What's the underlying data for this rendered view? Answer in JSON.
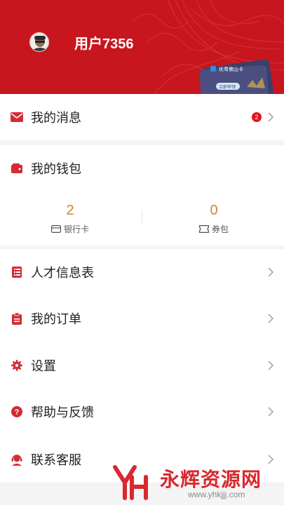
{
  "header": {
    "username": "用户7356",
    "promo_card_title": "优粤佛山卡",
    "promo_card_button": "立即申领"
  },
  "menu": {
    "messages": {
      "label": "我的消息",
      "badge": "2",
      "icon": "mail-icon"
    },
    "wallet": {
      "label": "我的钱包",
      "icon": "wallet-icon"
    },
    "talent_form": {
      "label": "人才信息表",
      "icon": "list-icon"
    },
    "orders": {
      "label": "我的订单",
      "icon": "clipboard-icon"
    },
    "settings": {
      "label": "设置",
      "icon": "gear-icon"
    },
    "help": {
      "label": "帮助与反馈",
      "icon": "question-icon"
    },
    "service": {
      "label": "联系客服",
      "icon": "headset-icon"
    }
  },
  "wallet_stats": {
    "bank_card_count": "2",
    "bank_card_label": "银行卡",
    "coupon_count": "0",
    "coupon_label": "券包"
  },
  "watermark": {
    "text": "永辉资源网",
    "url": "www.yhkjjj.com"
  },
  "colors": {
    "brand_red": "#c8161e",
    "accent_gold": "#c8862c",
    "icon_red": "#d42b34"
  }
}
